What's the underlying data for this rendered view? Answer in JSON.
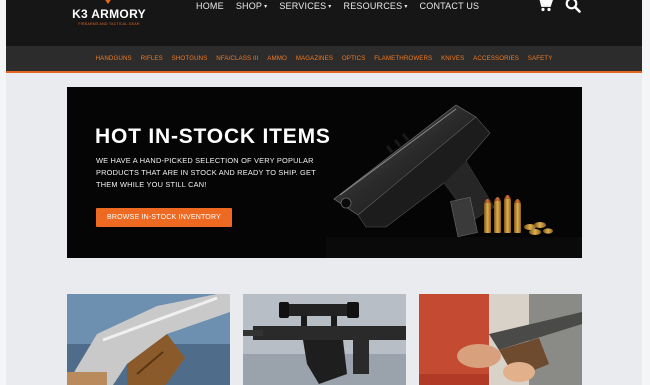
{
  "brand": {
    "name": "K3 ARMORY",
    "tagline": "FIREARMS AND TACTICAL GEAR",
    "accent": "#e8651f"
  },
  "nav": {
    "items": [
      {
        "label": "HOME",
        "caret": ""
      },
      {
        "label": "SHOP",
        "caret": "▾"
      },
      {
        "label": "SERVICES",
        "caret": "▾"
      },
      {
        "label": "RESOURCES",
        "caret": "▾"
      },
      {
        "label": "CONTACT US",
        "caret": ""
      }
    ],
    "icons": [
      "cart-icon",
      "search-icon"
    ]
  },
  "categories": [
    "HANDGUNS",
    "RIFLES",
    "SHOTGUNS",
    "NFA/CLASS III",
    "AMMO",
    "MAGAZINES",
    "OPTICS",
    "FLAMETHROWERS",
    "KNIVES",
    "ACCESSORIES",
    "SAFETY"
  ],
  "hero": {
    "title": "HOT IN-STOCK ITEMS",
    "description": "WE HAVE A HAND-PICKED SELECTION OF VERY POPULAR PRODUCTS THAT ARE IN STOCK AND READY TO SHIP. GET THEM WHILE YOU STILL CAN!",
    "button_label": "BROWSE IN-STOCK INVENTORY"
  },
  "tiles": [
    "handgun-photo",
    "rifle-photo",
    "shotgun-photo"
  ]
}
